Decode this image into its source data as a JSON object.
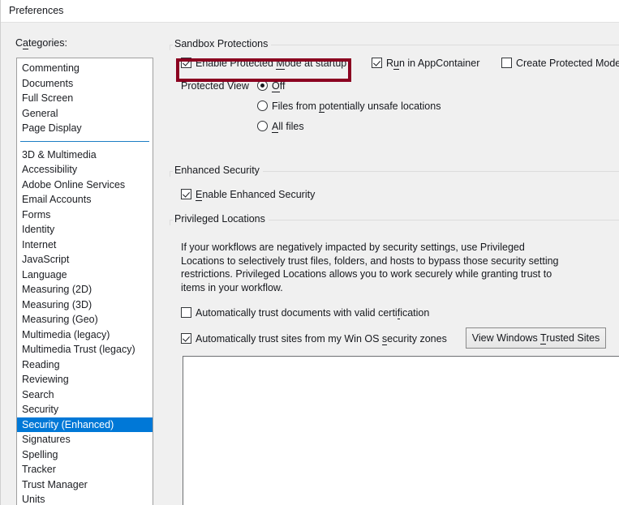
{
  "window": {
    "title": "Preferences"
  },
  "sidebar": {
    "label": "Categories:",
    "label_accel": "C",
    "groups": [
      {
        "items": [
          "Commenting",
          "Documents",
          "Full Screen",
          "General",
          "Page Display"
        ]
      },
      {
        "items": [
          "3D & Multimedia",
          "Accessibility",
          "Adobe Online Services",
          "Email Accounts",
          "Forms",
          "Identity",
          "Internet",
          "JavaScript",
          "Language",
          "Measuring (2D)",
          "Measuring (3D)",
          "Measuring (Geo)",
          "Multimedia (legacy)",
          "Multimedia Trust (legacy)",
          "Reading",
          "Reviewing",
          "Search",
          "Security",
          "Security (Enhanced)",
          "Signatures",
          "Spelling",
          "Tracker",
          "Trust Manager",
          "Units"
        ]
      }
    ],
    "selected": "Security (Enhanced)"
  },
  "sandbox": {
    "title": "Sandbox Protections",
    "enable_protected_mode": {
      "label_pre": "Enable Protected ",
      "label_accel": "M",
      "label_post": "ode at startup",
      "checked": true,
      "highlighted": true
    },
    "run_in_appcontainer": {
      "label_pre": "R",
      "label_accel": "u",
      "label_post": "n in AppContainer",
      "checked": true
    },
    "create_protected_mode_log": {
      "label_pre": "Create Protected Mode ",
      "label_accel": "l",
      "label_post": "",
      "checked": false
    },
    "protected_view": {
      "label": "Protected View",
      "options": [
        {
          "label_pre": "",
          "label_accel": "O",
          "label_post": "ff",
          "selected": true
        },
        {
          "label_pre": "Files from ",
          "label_accel": "p",
          "label_post": "otentially unsafe locations",
          "selected": false
        },
        {
          "label_pre": "",
          "label_accel": "A",
          "label_post": "ll files",
          "selected": false
        }
      ]
    }
  },
  "enhanced_security": {
    "title": "Enhanced Security",
    "enable": {
      "label_pre": "",
      "label_accel": "E",
      "label_post": "nable Enhanced Security",
      "checked": true
    }
  },
  "privileged_locations": {
    "title": "Privileged Locations",
    "description": "If your workflows are negatively impacted by security settings, use Privileged Locations to selectively trust files, folders, and hosts to bypass those security setting restrictions. Privileged Locations allows you to work securely while granting trust to items in your workflow.",
    "auto_trust_documents": {
      "label_pre": "Automatically trust documents with valid certi",
      "label_accel": "f",
      "label_post": "ication",
      "checked": false
    },
    "auto_trust_sites": {
      "label_pre": "Automatically trust sites from my Win OS ",
      "label_accel": "s",
      "label_post": "ecurity zones",
      "checked": true
    },
    "view_trusted_sites_button": {
      "label_pre": "View Windows ",
      "label_accel": "T",
      "label_post": "rusted Sites"
    },
    "trusted_list_items": []
  },
  "colors": {
    "highlight_box": "#8b0020",
    "selection": "#0078d7",
    "window_bg": "#f0f0f0",
    "separator_blue": "#1c7ec4"
  }
}
